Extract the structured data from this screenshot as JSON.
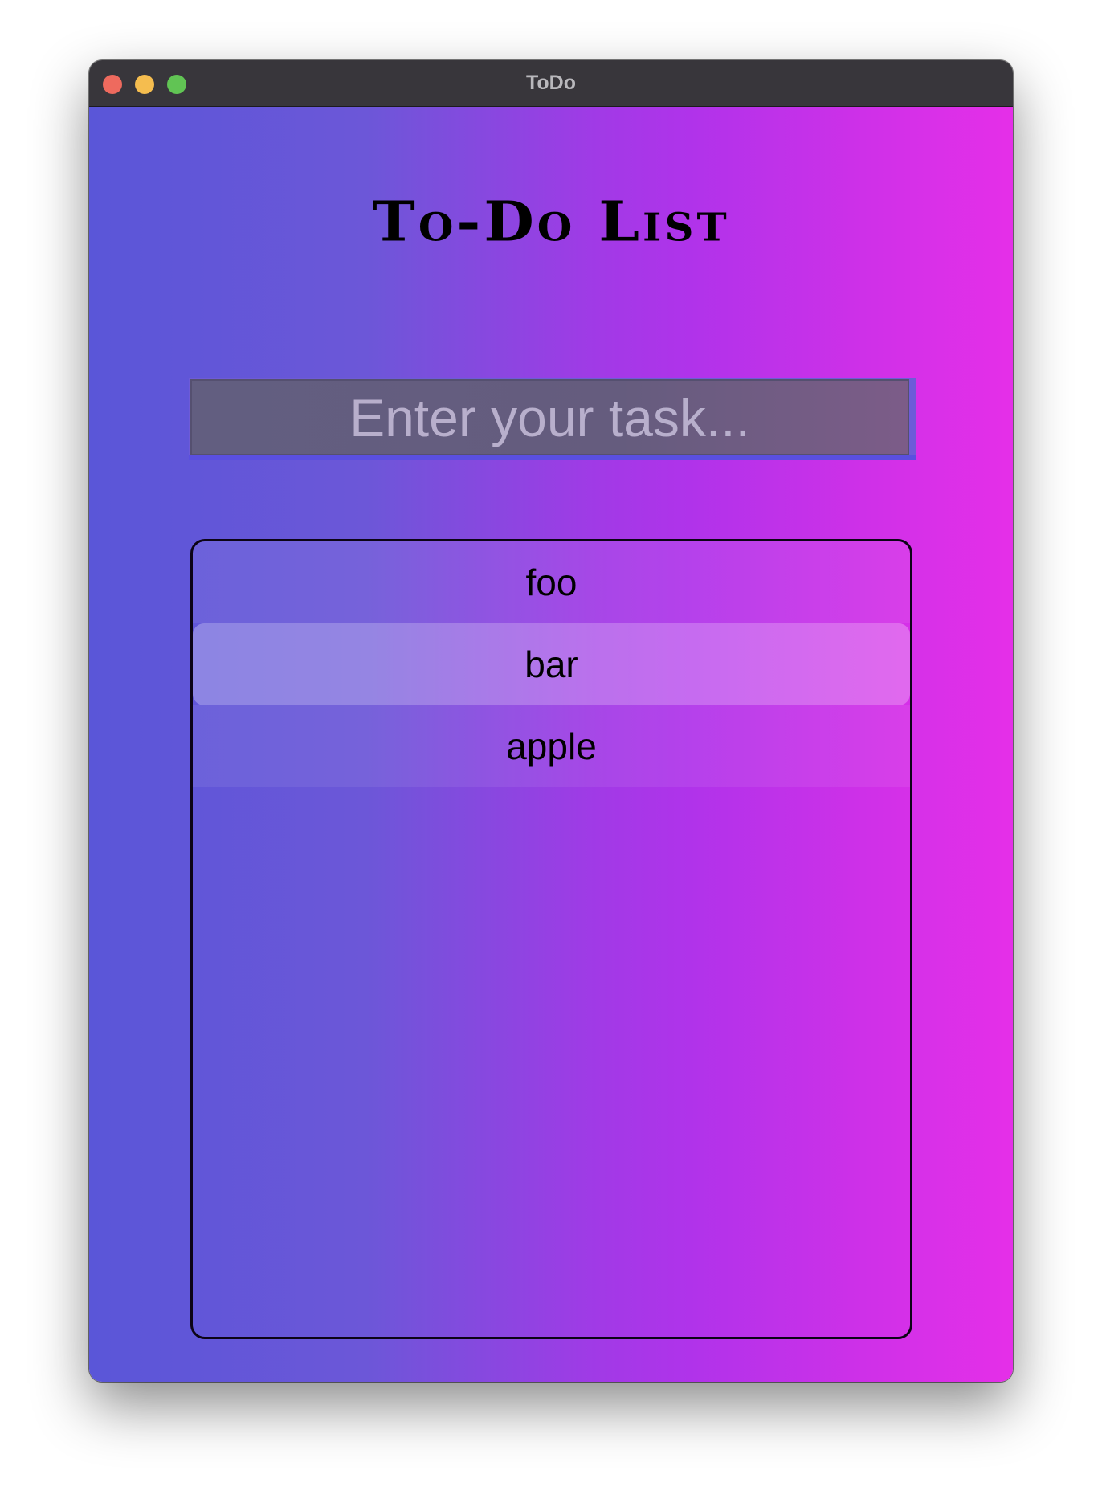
{
  "window": {
    "title": "ToDo"
  },
  "app": {
    "heading": "To-Do List"
  },
  "input": {
    "placeholder": "Enter your task...",
    "value": ""
  },
  "tasks": [
    {
      "label": "foo",
      "selected": false
    },
    {
      "label": "bar",
      "selected": true
    },
    {
      "label": "apple",
      "selected": false
    }
  ],
  "colors": {
    "gradient_start": "#5a56d8",
    "gradient_end": "#e52fe8",
    "titlebar": "#38363b"
  }
}
